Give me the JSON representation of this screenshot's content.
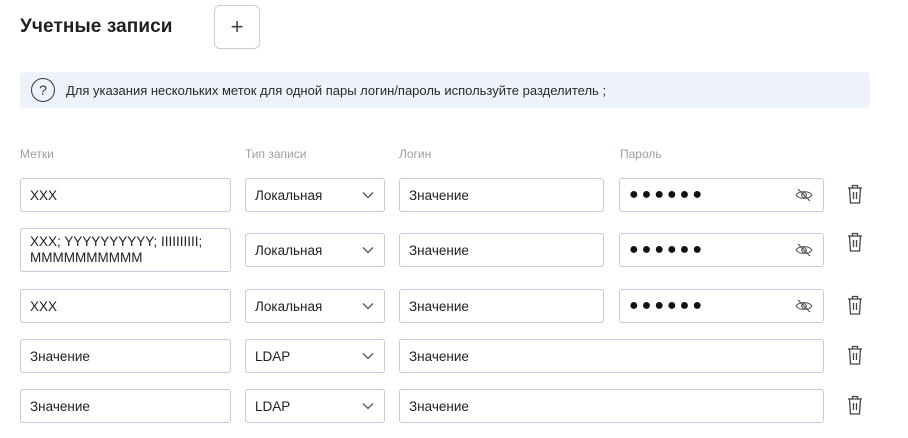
{
  "header": {
    "title": "Учетные записи",
    "add_label": "+"
  },
  "info": {
    "icon_text": "?",
    "text": "Для указания нескольких меток для одной пары логин/пароль используйте разделитель ;"
  },
  "columns": {
    "tags": "Метки",
    "type": "Тип записи",
    "login": "Логин",
    "password": "Пароль"
  },
  "rows": [
    {
      "tags": "XXX",
      "type": "Локальная",
      "login": "Значение",
      "password": "●●●●●●"
    },
    {
      "tags": "XXX; YYYYYYYYYY; IIIIIIIIII; MMMMMMMMMM",
      "type": "Локальная",
      "login": "Значение",
      "password": "●●●●●●"
    },
    {
      "tags": "XXX",
      "type": "Локальная",
      "login": "Значение",
      "password": "●●●●●●"
    },
    {
      "tags": "Значение",
      "type": "LDAP",
      "login": "Значение"
    },
    {
      "tags": "Значение",
      "type": "LDAP",
      "login": "Значение"
    }
  ],
  "icons": {
    "add": "plus-icon",
    "help": "question-circle-icon",
    "chevron": "chevron-down-icon",
    "eye": "eye-off-icon",
    "delete": "trash-icon"
  },
  "colors": {
    "info_bg": "#eef2fa",
    "border": "#c3ccd8",
    "label": "#9aa0a8"
  }
}
